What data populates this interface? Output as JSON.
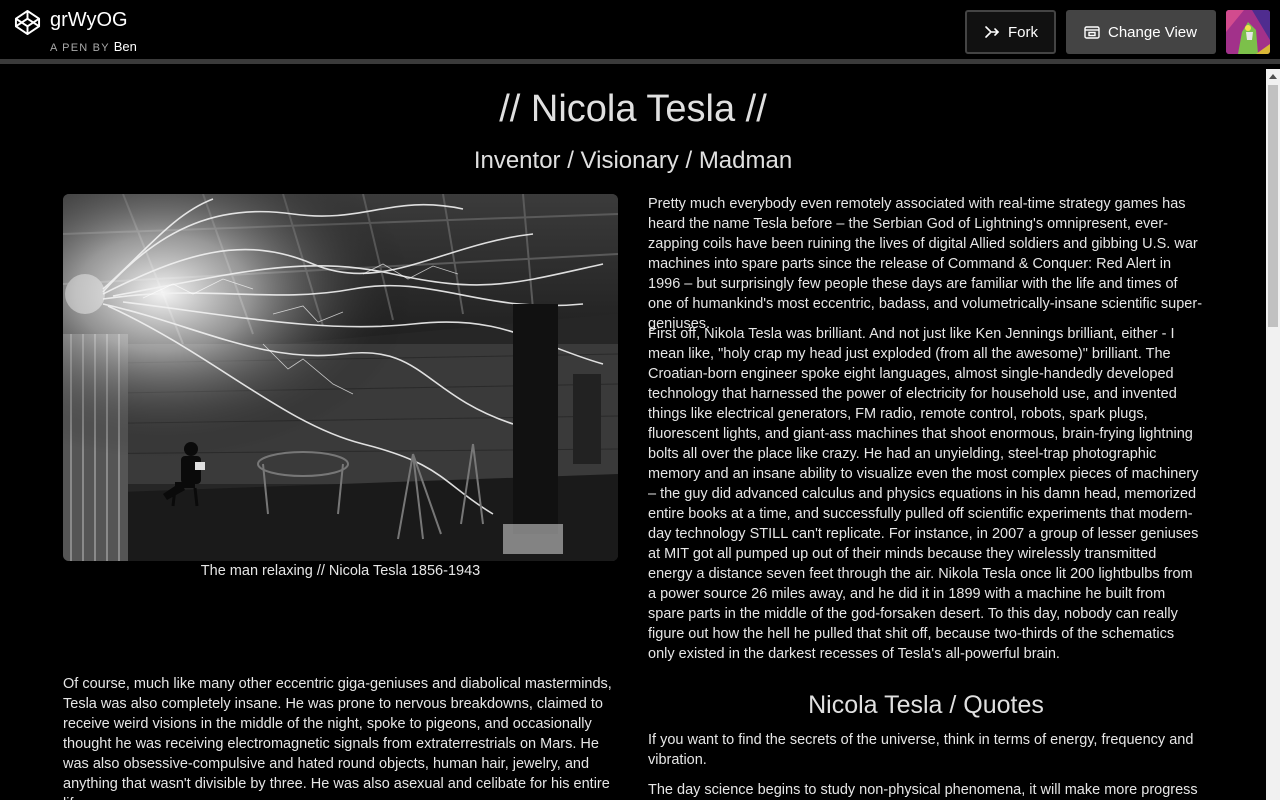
{
  "header": {
    "pen_title": "grWyOG",
    "pen_by_label": "A PEN BY",
    "author": "Ben",
    "fork_label": "Fork",
    "change_view_label": "Change View",
    "logo_icon": "codepen-logo-icon",
    "fork_icon": "fork-icon",
    "change_view_icon": "window-icon"
  },
  "page": {
    "title": "// Nicola Tesla //",
    "subtitle": "Inventor / Visionary / Madman",
    "image_caption": "The man relaxing // Nicola Tesla 1856-1943",
    "paragraphs": [
      "Pretty much everybody even remotely associated with real-time strategy games has heard the name Tesla before – the Serbian God of Lightning's omnipresent, ever-zapping coils have been ruining the lives of digital Allied soldiers and gibbing U.S. war machines into spare parts since the release of Command & Conquer: Red Alert in 1996 – but surprisingly few people these days are familiar with the life and times of one of humankind's most eccentric, badass, and volumetrically-insane scientific super-geniuses.",
      "First off, Nikola Tesla was brilliant. And not just like Ken Jennings brilliant, either - I mean like, \"holy crap my head just exploded (from all the awesome)\" brilliant. The Croatian-born engineer spoke eight languages, almost single-handedly developed technology that harnessed the power of electricity for household use, and invented things like electrical generators, FM radio, remote control, robots, spark plugs, fluorescent lights, and giant-ass machines that shoot enormous, brain-frying lightning bolts all over the place like crazy. He had an unyielding, steel-trap photographic memory and an insane ability to visualize even the most complex pieces of machinery – the guy did advanced calculus and physics equations in his damn head, memorized entire books at a time, and successfully pulled off scientific experiments that modern-day technology STILL can't replicate. For instance, in 2007 a group of lesser geniuses at MIT got all pumped up out of their minds because they wirelessly transmitted energy a distance seven feet through the air. Nikola Tesla once lit 200 lightbulbs from a power source 26 miles away, and he did it in 1899 with a machine he built from spare parts in the middle of the god-forsaken desert. To this day, nobody can really figure out how the hell he pulled that shit off, because two-thirds of the schematics only existed in the darkest recesses of Tesla's all-powerful brain.",
      "Of course, much like many other eccentric giga-geniuses and diabolical masterminds, Tesla was also completely insane. He was prone to nervous breakdowns, claimed to receive weird visions in the middle of the night, spoke to pigeons, and occasionally thought he was receiving electromagnetic signals from extraterrestrials on Mars. He was also obsessive-compulsive and hated round objects, human hair, jewelry, and anything that wasn't divisible by three. He was also asexual and celibate for his entire life."
    ],
    "quotes_title": "Nicola Tesla / Quotes",
    "quotes": [
      "If you want to find the secrets of the universe, think in terms of energy, frequency and vibration.",
      "The day science begins to study non-physical phenomena, it will make more progress in one decade than in all the previous centuries of its existence."
    ]
  }
}
